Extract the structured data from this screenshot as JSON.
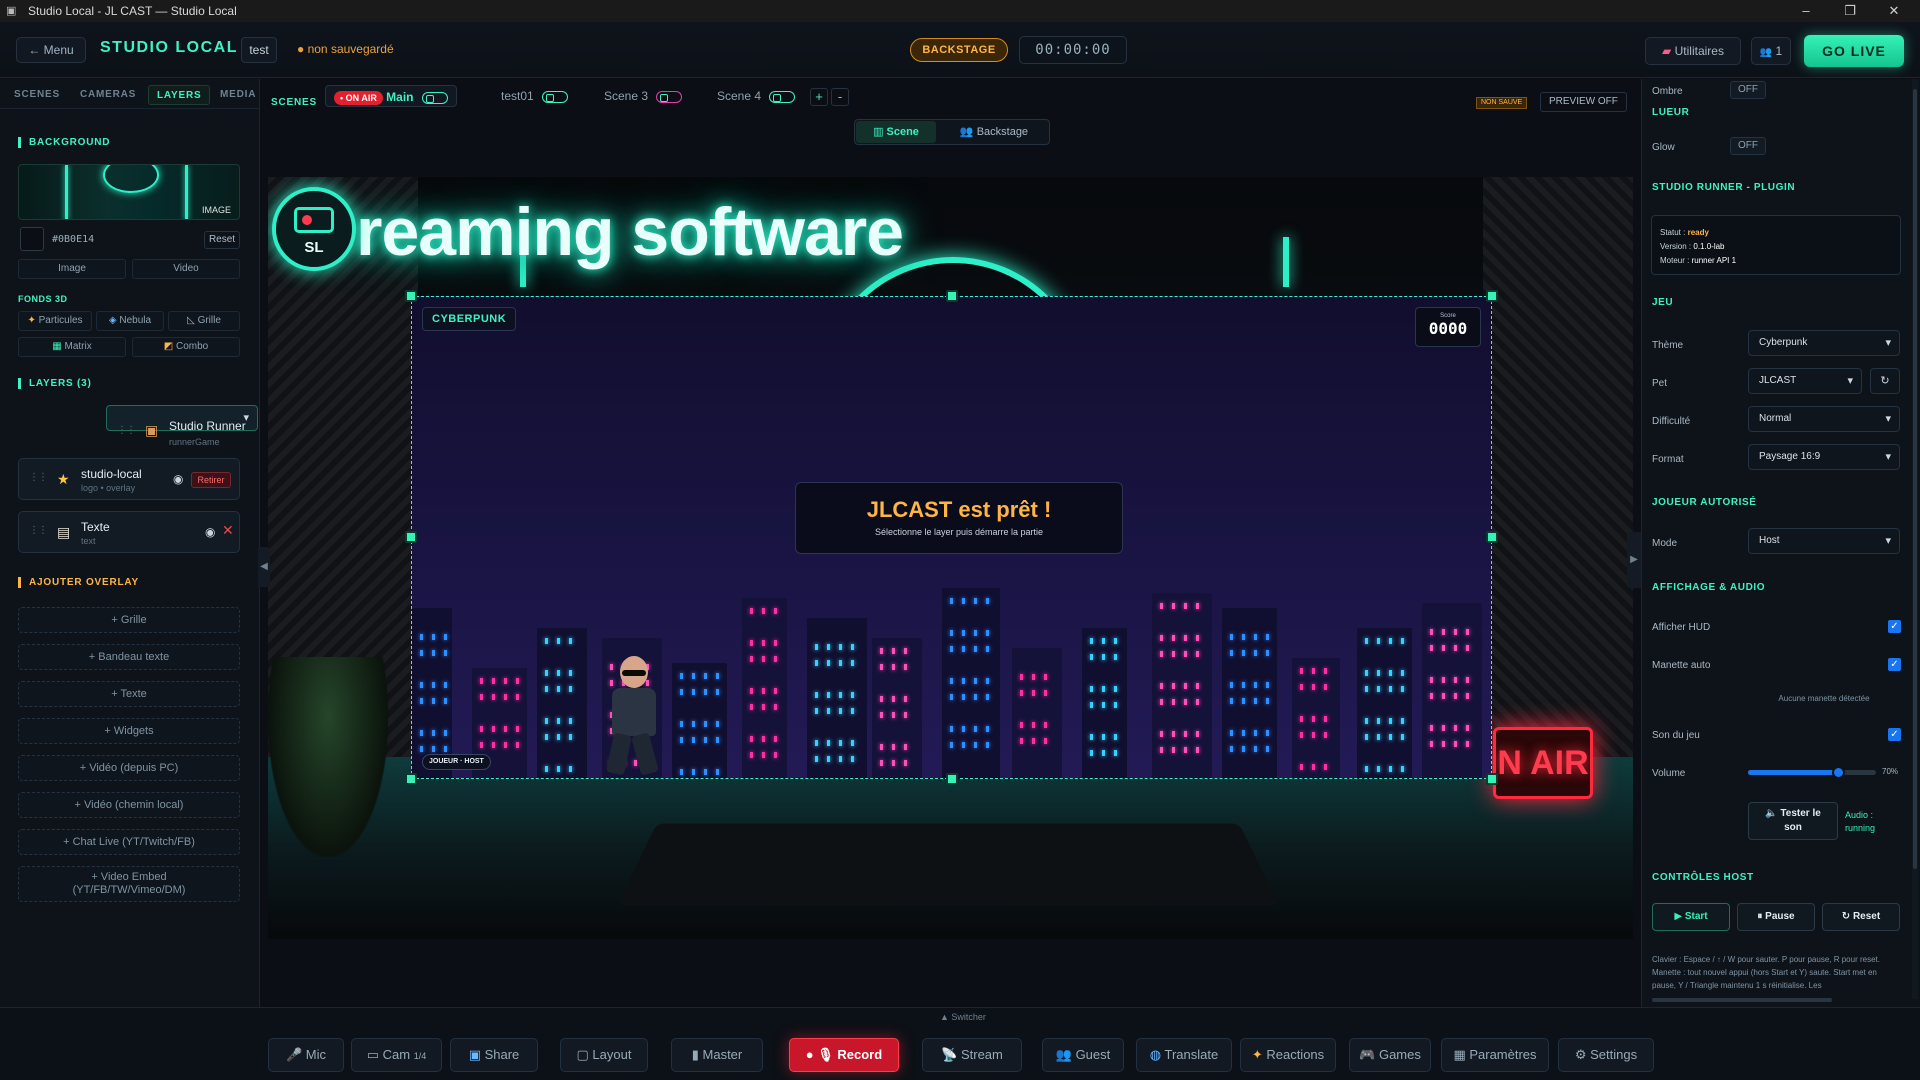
{
  "window": {
    "title": "Studio Local - JL CAST — Studio Local",
    "controls": [
      "–",
      "❐",
      "✕"
    ]
  },
  "topbar": {
    "menu_label": "← Menu",
    "app_name": "STUDIO LOCAL",
    "project_name": "test",
    "save_status": "● non sauvegardé",
    "mode_badge": "BACKSTAGE",
    "timer": "00:00:00",
    "utilities_label": "Utilitaires",
    "guests_count": "1",
    "golive_label": "GO LIVE"
  },
  "sidebar": {
    "tabs": [
      "SCENES",
      "CAMERAS",
      "LAYERS",
      "MEDIA"
    ],
    "active_tab": "LAYERS",
    "background": {
      "heading": "BACKGROUND",
      "thumb_tag": "IMAGE",
      "color_hex": "#0B0E14",
      "reset_label": "Reset",
      "type_options": [
        "Image",
        "Video"
      ]
    },
    "fonds3d": {
      "heading": "FONDS 3D",
      "options": [
        "Particules",
        "Nebula",
        "Grille",
        "Matrix",
        "Combo"
      ]
    },
    "layers": {
      "heading": "LAYERS (3)",
      "items": [
        {
          "name": "Studio Runner",
          "sub": "runnerGame"
        },
        {
          "name": "studio-local",
          "sub": "logo • overlay",
          "action": "Retirer"
        },
        {
          "name": "Texte",
          "sub": "text"
        }
      ]
    },
    "overlays": {
      "heading": "AJOUTER OVERLAY",
      "items": [
        "+ Grille",
        "+ Bandeau texte",
        "+ Texte",
        "+ Widgets",
        "+ Vidéo (depuis PC)",
        "+ Vidéo (chemin local)",
        "+ Chat Live (YT/Twitch/FB)",
        "+ Video Embed",
        "(YT/FB/TW/Vimeo/DM)"
      ]
    }
  },
  "scenes": {
    "label": "SCENES",
    "onair_badge": "• ON AIR",
    "tabs": [
      "Main",
      "test01",
      "Scene 3",
      "Scene 4"
    ],
    "add_label": "+",
    "remove_label": "-",
    "not_saved": "NON SAUVE",
    "preview_label": "PREVIEW OFF",
    "view_toggle": [
      "Scene",
      "Backstage"
    ]
  },
  "stage": {
    "banner_text": "reaming software",
    "logo_text": "SL",
    "onair_sign": "N AIR",
    "game": {
      "theme_tag": "CYBERPUNK",
      "score_label": "Score",
      "score_value": "0000",
      "ready_title": "JLCAST est prêt !",
      "ready_sub": "Sélectionne le layer puis démarre la partie",
      "player_tag": "JOUEUR · HOST"
    }
  },
  "right": {
    "ombre_label": "Ombre",
    "ombre_value": "OFF",
    "lueur_heading": "LUEUR",
    "glow_label": "Glow",
    "glow_value": "OFF",
    "plugin_heading": "STUDIO RUNNER - PLUGIN",
    "plugin": {
      "statut_k": "Statut :",
      "statut_v": "ready",
      "version_k": "Version :",
      "version_v": "0.1.0-lab",
      "moteur_k": "Moteur :",
      "moteur_v": "runner API 1"
    },
    "jeu_heading": "JEU",
    "theme_label": "Thème",
    "theme_value": "Cyberpunk",
    "pet_label": "Pet",
    "pet_value": "JLCAST",
    "pet_refresh": "↻",
    "difficulty_label": "Difficulté",
    "difficulty_value": "Normal",
    "format_label": "Format",
    "format_value": "Paysage 16:9",
    "joueur_heading": "JOUEUR AUTORISÉ",
    "mode_label": "Mode",
    "mode_value": "Host",
    "affichage_heading": "AFFICHAGE & AUDIO",
    "hud_label": "Afficher HUD",
    "hud_checked": true,
    "manette_label": "Manette auto",
    "manette_checked": true,
    "manette_note": "Aucune manette détectée",
    "son_label": "Son du jeu",
    "son_checked": true,
    "volume_label": "Volume",
    "volume_value": 0.7,
    "volume_text": "70%",
    "test_son_label": "🔈 Tester le son",
    "audio_status": "Audio : running",
    "controles_heading": "CONTRÔLES HOST",
    "start_label": "▶ Start",
    "pause_label": "⏸ Pause",
    "reset_label": "↻ Reset",
    "help_text": "Clavier : Espace / ↑ / W pour sauter. P pour pause, R pour reset. Manette : tout nouvel appui (hors Start et Y) saute. Start met en pause, Y / Triangle maintenu 1 s réinitialise. Les"
  },
  "bottombar": {
    "switcher_label": "▲ Switcher",
    "buttons": {
      "mic": "Mic",
      "cam": "Cam",
      "cam_count": "1/4",
      "share": "Share",
      "layout": "Layout",
      "master": "Master",
      "record": "Record",
      "stream": "Stream",
      "guest": "Guest",
      "translate": "Translate",
      "reactions": "Reactions",
      "games": "Games",
      "parametres": "Paramètres",
      "settings": "Settings"
    }
  },
  "colors": {
    "accent": "#3ff2c3",
    "record": "#e5202e",
    "warning": "#ffb545",
    "bg": "#0b0e14"
  }
}
